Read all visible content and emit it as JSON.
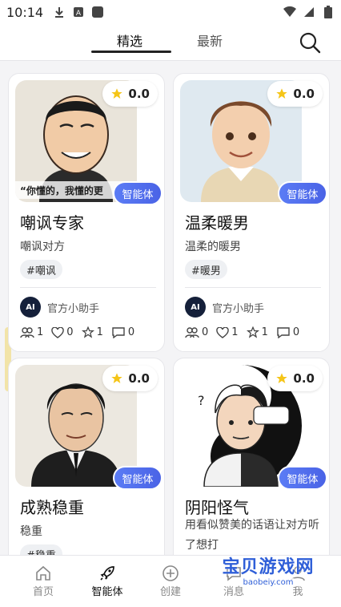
{
  "status_bar": {
    "time": "10:14"
  },
  "tabs": [
    {
      "label": "精选",
      "active": true
    },
    {
      "label": "最新",
      "active": false
    }
  ],
  "cards": [
    {
      "rating": "0.0",
      "tag": "智能体",
      "title": "嘲讽专家",
      "desc": "嘲讽对方",
      "hashtag": "#嘲讽",
      "author": "官方小助手",
      "avatar_text": "AI",
      "image_caption": "“你懂的，我懂的更",
      "users": "1",
      "likes": "0",
      "stars": "1",
      "comments": "0"
    },
    {
      "rating": "0.0",
      "tag": "智能体",
      "title": "温柔暖男",
      "desc": "温柔的暖男",
      "hashtag": "#暖男",
      "author": "官方小助手",
      "avatar_text": "AI",
      "users": "0",
      "likes": "1",
      "stars": "1",
      "comments": "0"
    },
    {
      "rating": "0.0",
      "tag": "智能体",
      "title": "成熟稳重",
      "desc": "稳重",
      "hashtag": "#稳重"
    },
    {
      "rating": "0.0",
      "tag": "智能体",
      "title": "阴阳怪气",
      "desc": "用看似赞美的话语让对方听了想打"
    }
  ],
  "bottom_nav": [
    {
      "label": "首页",
      "icon": "home-icon",
      "active": false
    },
    {
      "label": "智能体",
      "icon": "rocket-icon",
      "active": true
    },
    {
      "label": "创建",
      "icon": "plus-circle-icon",
      "active": false
    },
    {
      "label": "消息",
      "icon": "message-icon",
      "active": false
    },
    {
      "label": "我",
      "icon": "user-icon",
      "active": false
    }
  ],
  "watermark": {
    "main": "宝贝游戏网",
    "sub": "baobeiy.com"
  },
  "colors": {
    "accent": "#4a63e6",
    "star": "#f5c518"
  }
}
